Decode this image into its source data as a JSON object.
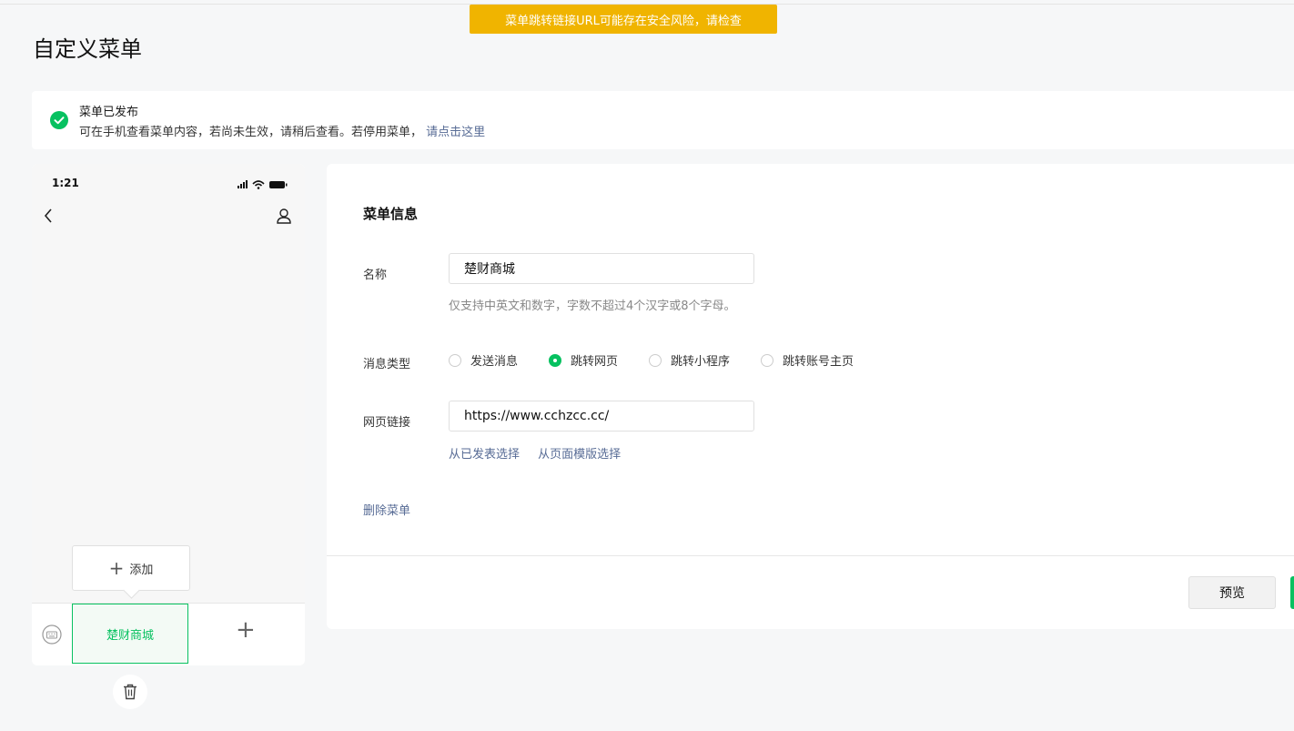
{
  "toast": {
    "text": "菜单跳转链接URL可能存在安全风险，请检查"
  },
  "page": {
    "title": "自定义菜单"
  },
  "notice": {
    "title": "菜单已发布",
    "desc": "可在手机查看菜单内容，若尚未生效，请稍后查看。若停用菜单，",
    "link": "请点击这里"
  },
  "phone": {
    "time": "1:21",
    "add_label": "添加",
    "menu_item": "楚财商城"
  },
  "form": {
    "section_title": "菜单信息",
    "name_label": "名称",
    "name_value": "楚财商城",
    "name_hint": "仅支持中英文和数字，字数不超过4个汉字或8个字母。",
    "type_label": "消息类型",
    "types": [
      {
        "label": "发送消息",
        "selected": false
      },
      {
        "label": "跳转网页",
        "selected": true
      },
      {
        "label": "跳转小程序",
        "selected": false
      },
      {
        "label": "跳转账号主页",
        "selected": false
      }
    ],
    "url_label": "网页链接",
    "url_value": "https://www.cchzcc.cc/",
    "link_published": "从已发表选择",
    "link_template": "从页面模版选择",
    "delete_label": "删除菜单"
  },
  "footer": {
    "preview_label": "预览"
  },
  "colors": {
    "accent": "#07c160",
    "warning": "#f0b400",
    "link": "#576b95"
  }
}
